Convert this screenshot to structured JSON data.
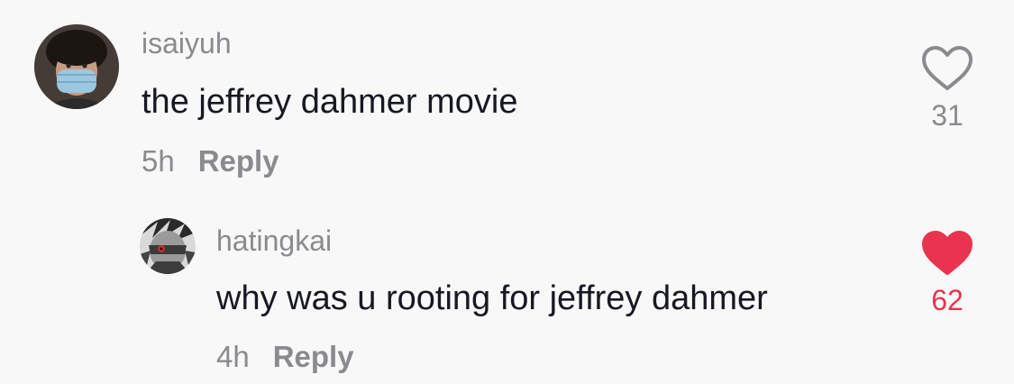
{
  "comments": [
    {
      "username": "isaiyuh",
      "text": "the jeffrey dahmer movie",
      "time": "5h",
      "reply_label": "Reply",
      "like_count": "31",
      "liked": false,
      "avatar_icon": "avatar-masked-person"
    },
    {
      "username": "hatingkai",
      "text": "why was u rooting for jeffrey dahmer",
      "time": "4h",
      "reply_label": "Reply",
      "like_count": "62",
      "liked": true,
      "avatar_icon": "avatar-anime-character"
    }
  ],
  "colors": {
    "background": "#f8f8f8",
    "text": "#161823",
    "muted": "#8a8a8f",
    "like_active": "#e8344f"
  }
}
